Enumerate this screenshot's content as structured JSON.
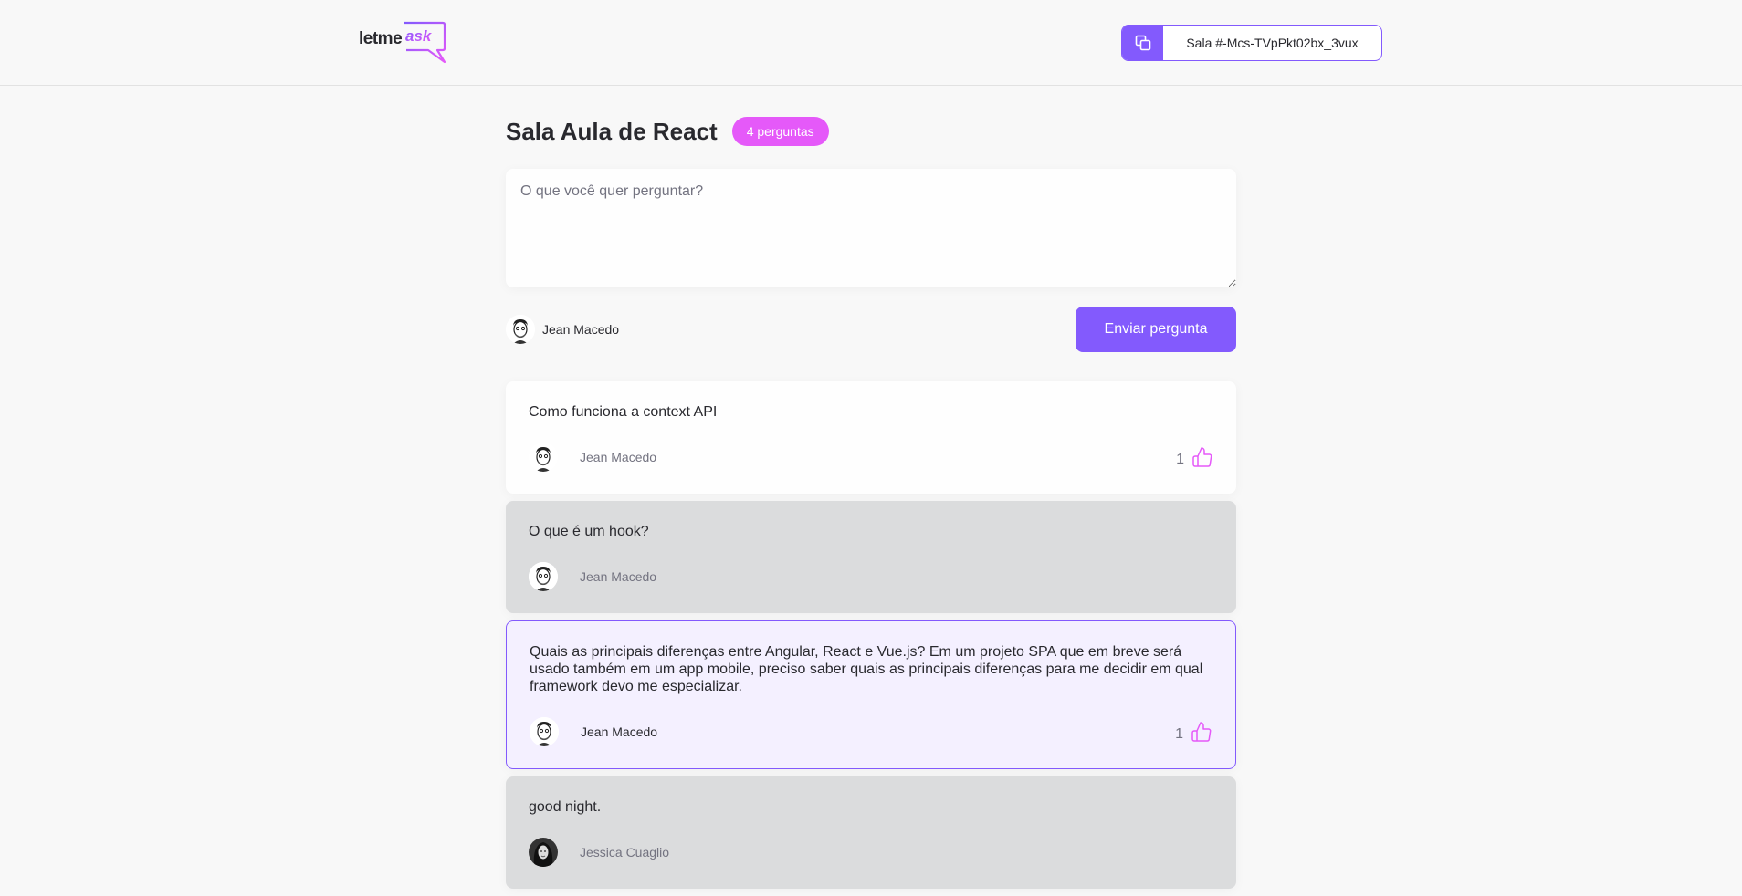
{
  "header": {
    "logo_text": "letme",
    "logo_accent": "ask",
    "room_code": "Sala #-Mcs-TVpPkt02bx_3vux"
  },
  "room": {
    "title": "Sala Aula de React",
    "count_badge": "4 perguntas"
  },
  "form": {
    "placeholder": "O que você quer perguntar?",
    "user_name": "Jean Macedo",
    "send_label": "Enviar pergunta"
  },
  "questions": [
    {
      "content": "Como funciona a context API",
      "author": "Jean Macedo",
      "likes": "1"
    },
    {
      "content": "O que é um hook?",
      "author": "Jean Macedo"
    },
    {
      "content": "Quais as principais diferenças entre Angular, React e Vue.js? Em um projeto SPA que em breve será usado também em um app mobile, preciso saber quais as principais diferenças para me decidir em qual framework devo me especializar.",
      "author": "Jean Macedo",
      "likes": "1"
    },
    {
      "content": "good night.",
      "author": "Jessica Cuaglio"
    }
  ],
  "colors": {
    "primary": "#835afd",
    "badge": "#e559f9",
    "answered_bg": "#dbdcdd",
    "highlighted_bg": "#f4f0ff"
  }
}
